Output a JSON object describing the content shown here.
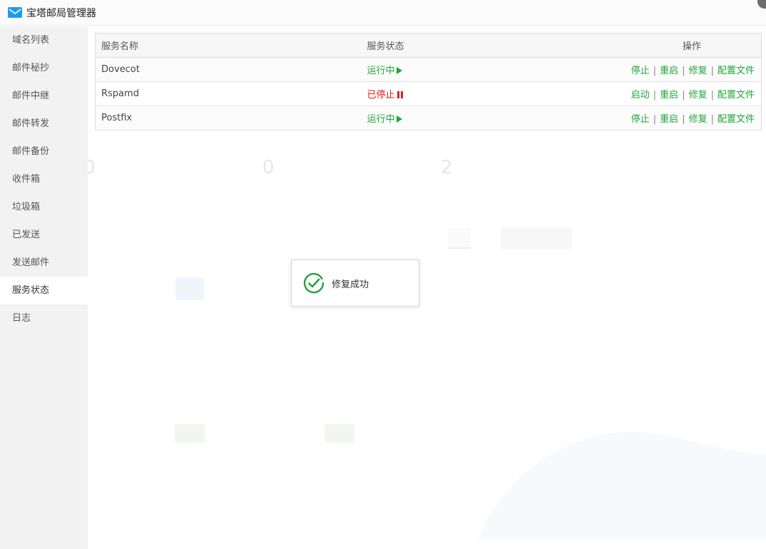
{
  "window": {
    "title": "宝塔邮局管理器"
  },
  "sidebar": {
    "items": [
      {
        "label": "域名列表"
      },
      {
        "label": "邮件秘抄"
      },
      {
        "label": "邮件中继"
      },
      {
        "label": "邮件转发"
      },
      {
        "label": "邮件备份"
      },
      {
        "label": "收件箱"
      },
      {
        "label": "垃圾箱"
      },
      {
        "label": "已发送"
      },
      {
        "label": "发送邮件"
      },
      {
        "label": "服务状态"
      },
      {
        "label": "日志"
      }
    ],
    "active_index": 9
  },
  "table": {
    "headers": {
      "name": "服务名称",
      "status": "服务状态",
      "ops": "操作"
    },
    "rows": [
      {
        "name": "Dovecot",
        "status": "运行中",
        "state": "running",
        "op1": "停止",
        "op2": "重启",
        "op3": "修复",
        "op4": "配置文件"
      },
      {
        "name": "Rspamd",
        "status": "已停止",
        "state": "stopped",
        "op1": "启动",
        "op2": "重启",
        "op3": "修复",
        "op4": "配置文件"
      },
      {
        "name": "Postfix",
        "status": "运行中",
        "state": "running",
        "op1": "停止",
        "op2": "重启",
        "op3": "修复",
        "op4": "配置文件"
      }
    ],
    "separator": "|"
  },
  "toast": {
    "message": "修复成功"
  },
  "colors": {
    "accent_green": "#20a53a",
    "stopped_red": "#e21a1a",
    "app_icon_blue": "#1e9bf0"
  },
  "icons": {
    "app": "mail-icon",
    "toast": "check-circle-icon"
  }
}
